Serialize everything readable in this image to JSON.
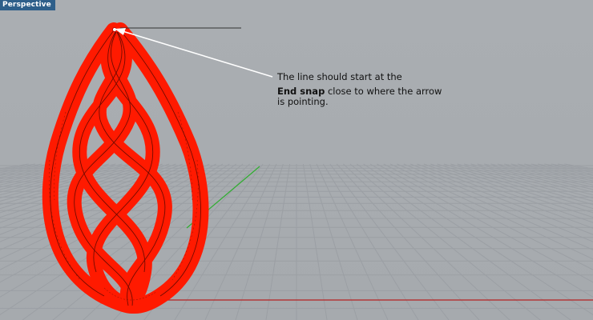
{
  "viewport": {
    "title": "Perspective",
    "background_color": "#a9adb1",
    "tab_color": "#2e5f8a"
  },
  "scene": {
    "object": "twisted-lattice-vase",
    "object_color": "#ff1a00",
    "grid_color": "#9a9ea3",
    "x_axis_color": "#b82020",
    "y_axis_color": "#33b033"
  },
  "annotation": {
    "line1": "The line should start at the",
    "bold": "End snap",
    "line2_rest": " close to where the arrow",
    "line3": "is pointing."
  }
}
